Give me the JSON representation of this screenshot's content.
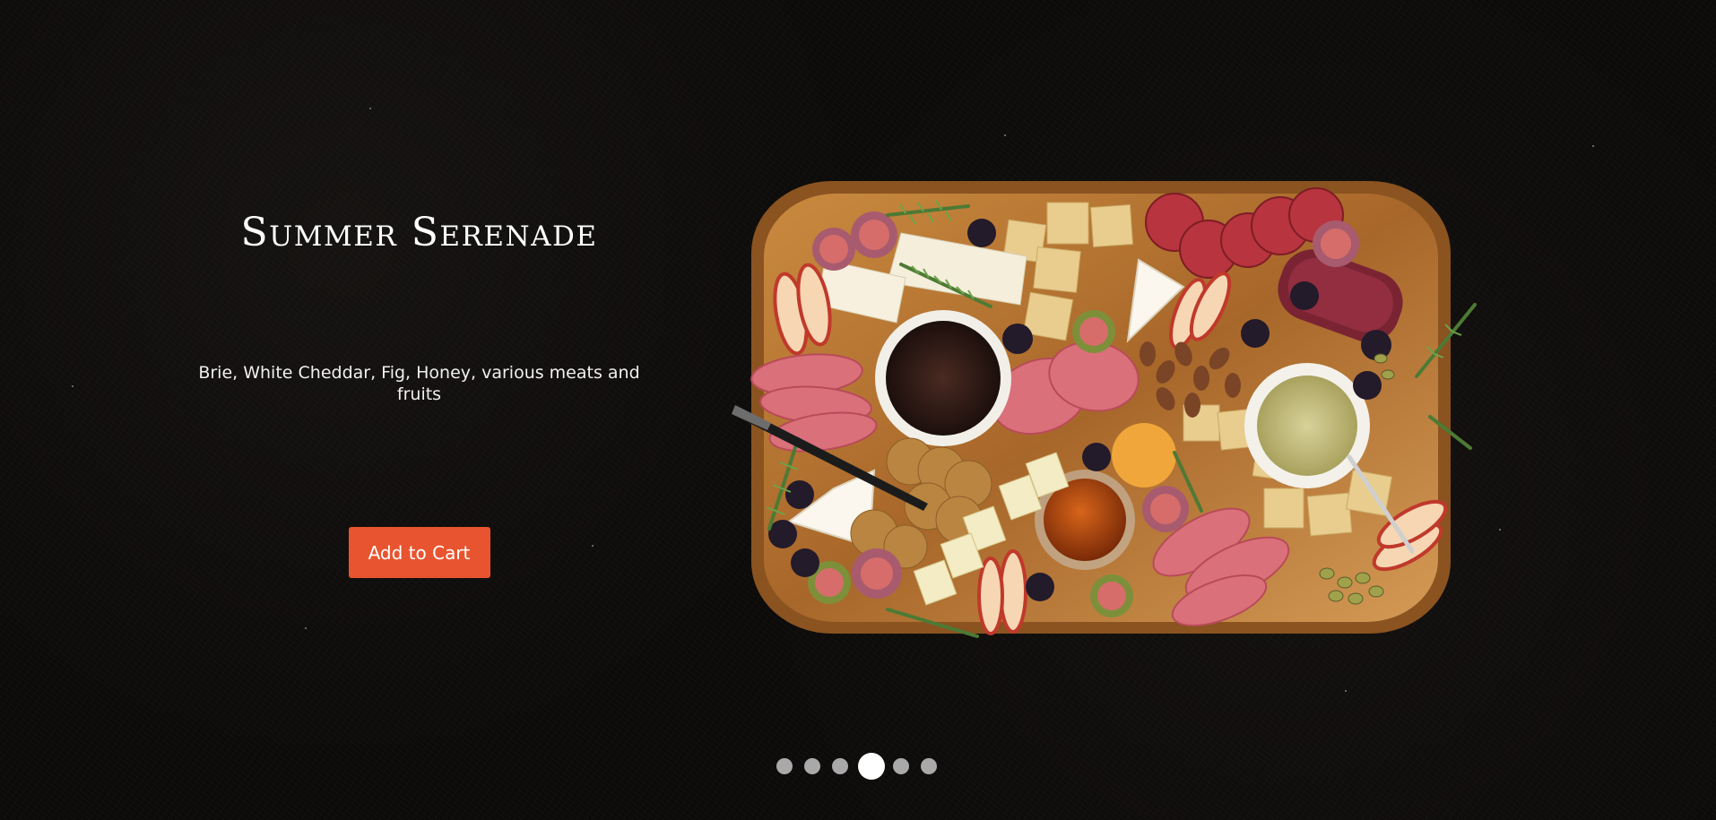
{
  "slide": {
    "title": "Summer Serenade",
    "description": "Brie, White Cheddar, Fig, Honey, various meats and fruits",
    "cta_label": "Add to Cart"
  },
  "carousel": {
    "total_slides": 6,
    "active_slide": 4
  },
  "colors": {
    "background": "#0d0b0a",
    "cta": "#e8542f",
    "dot_inactive": "#a9a9a9",
    "dot_active": "#ffffff"
  }
}
